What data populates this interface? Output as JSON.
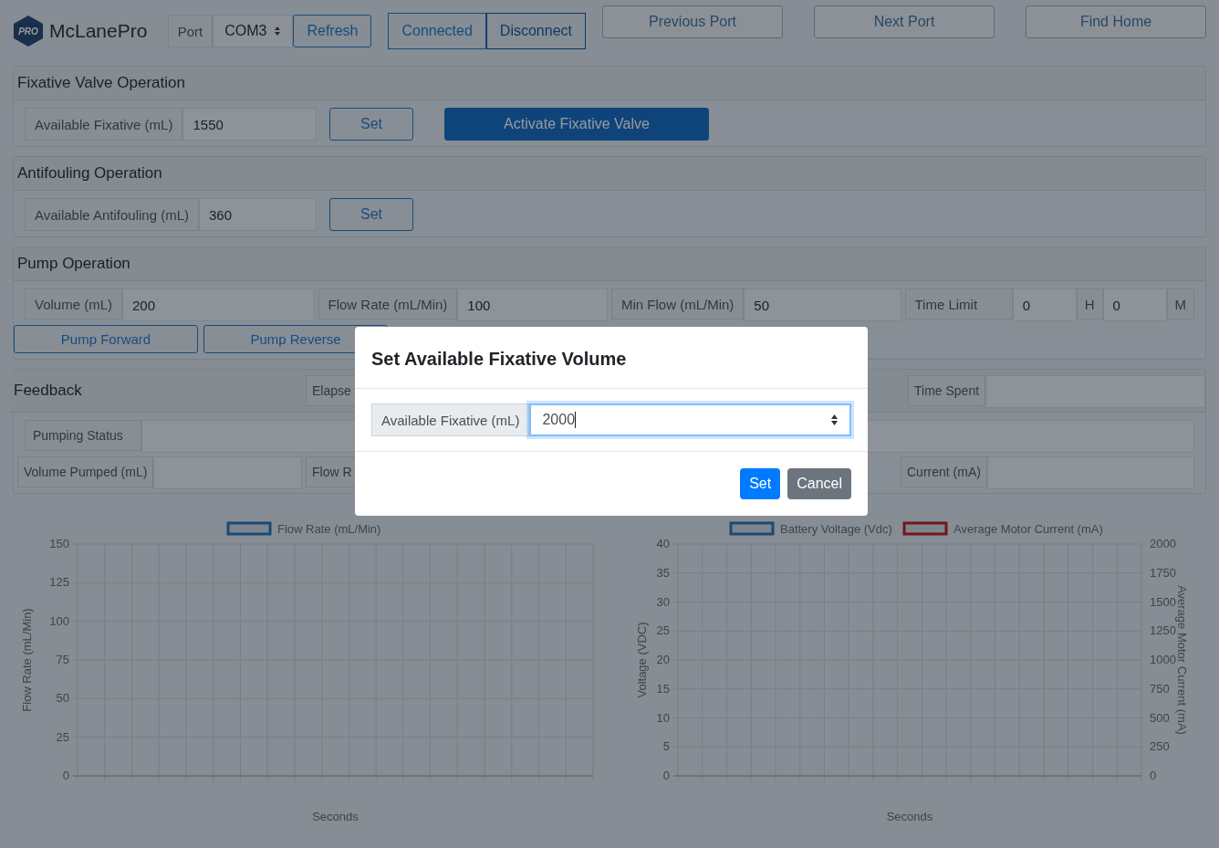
{
  "header": {
    "logo_badge": "PRO",
    "app_name": "McLanePro",
    "port_label": "Port",
    "port_value": "COM3",
    "refresh": "Refresh",
    "status": "Connected",
    "disconnect": "Disconnect",
    "nav_buttons": [
      "Previous Port",
      "Next Port",
      "Find Home"
    ]
  },
  "fixative": {
    "title": "Fixative Valve Operation",
    "label": "Available Fixative (mL)",
    "value": "1550",
    "set": "Set",
    "activate": "Activate Fixative Valve"
  },
  "antifouling": {
    "title": "Antifouling Operation",
    "label": "Available Antifouling (mL)",
    "value": "360",
    "set": "Set"
  },
  "pump": {
    "title": "Pump Operation",
    "fields": [
      {
        "label": "Volume (mL)",
        "value": "200"
      },
      {
        "label": "Flow Rate (mL/Min)",
        "value": "100"
      },
      {
        "label": "Min Flow (mL/Min)",
        "value": "50"
      }
    ],
    "time_limit": {
      "label": "Time Limit",
      "hours": "0",
      "hours_unit": "H",
      "minutes": "0",
      "minutes_unit": "M"
    },
    "buttons": [
      "Pump Forward",
      "Pump Reverse"
    ]
  },
  "feedback": {
    "title": "Feedback",
    "header_fields": [
      {
        "label": "Elapse"
      },
      {
        "label": "Time Spent"
      }
    ],
    "status_label": "Pumping Status",
    "fields": [
      {
        "label": "Volume Pumped (mL)"
      },
      {
        "label": "Flow R"
      },
      {
        "label": "Current (mA)"
      }
    ]
  },
  "charts": [
    {
      "chart_data": {
        "type": "line",
        "grid": true,
        "xlabel": "Seconds",
        "ylabel": "Flow Rate (mL/Min)",
        "ylim": [
          0,
          150
        ],
        "yticks": [
          0,
          25,
          50,
          75,
          100,
          125,
          150
        ],
        "series": [
          {
            "name": "Flow Rate (mL/Min)",
            "color": "#1f6fb4"
          }
        ]
      }
    },
    {
      "chart_data": {
        "type": "line",
        "grid": true,
        "xlabel": "Seconds",
        "ylabel": "Voltage (VDC)",
        "ylim": [
          0,
          40
        ],
        "yticks": [
          0,
          5,
          10,
          15,
          20,
          25,
          30,
          35,
          40
        ],
        "y2label": "Average Motor Current (mA)",
        "y2lim": [
          0,
          2000
        ],
        "y2ticks": [
          0,
          250,
          500,
          750,
          1000,
          1250,
          1500,
          1750,
          2000
        ],
        "series": [
          {
            "name": "Battery Voltage (Vdc)",
            "color": "#1f6fb4"
          },
          {
            "name": "Average Motor Current (mA)",
            "color": "#c0131a"
          }
        ]
      }
    }
  ],
  "modal": {
    "title": "Set Available Fixative Volume",
    "label": "Available Fixative (mL)",
    "value": "2000",
    "buttons": [
      {
        "label": "Set",
        "kind": "primary"
      },
      {
        "label": "Cancel",
        "kind": "secondary"
      }
    ]
  }
}
